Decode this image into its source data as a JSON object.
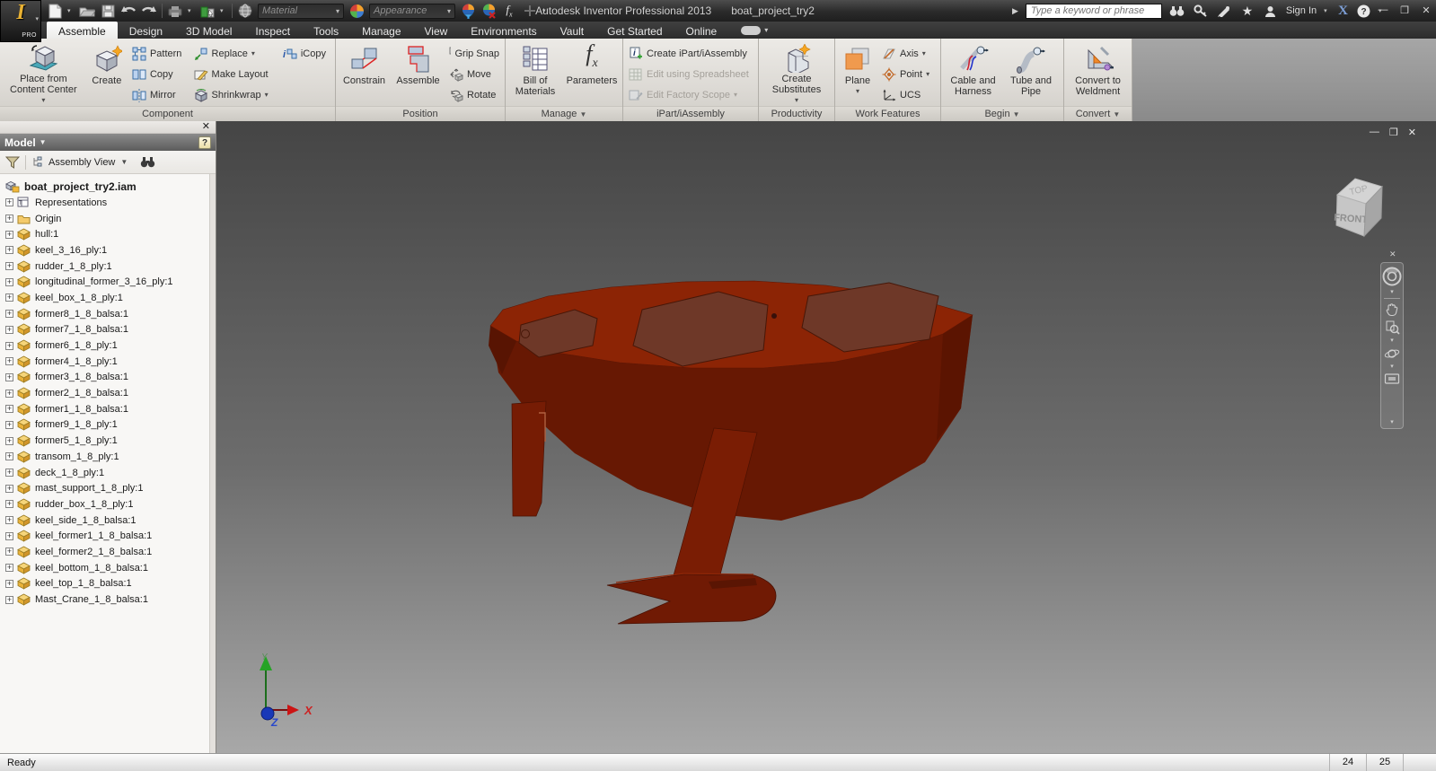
{
  "title_bar": {
    "app_badge": "PRO",
    "title": "Autodesk Inventor Professional 2013",
    "document": "boat_project_try2",
    "search_placeholder": "Type a keyword or phrase",
    "sign_in": "Sign In",
    "material_label": "Material",
    "appearance_label": "Appearance"
  },
  "tabs": [
    "Assemble",
    "Design",
    "3D Model",
    "Inspect",
    "Tools",
    "Manage",
    "View",
    "Environments",
    "Vault",
    "Get Started",
    "Online"
  ],
  "active_tab": "Assemble",
  "ribbon": {
    "component": {
      "label": "Component",
      "place": "Place from Content Center",
      "create": "Create",
      "pattern": "Pattern",
      "copy": "Copy",
      "mirror": "Mirror",
      "replace": "Replace",
      "make_layout": "Make Layout",
      "shrinkwrap": "Shrinkwrap",
      "icopy": "iCopy"
    },
    "position": {
      "label": "Position",
      "constrain": "Constrain",
      "assemble": "Assemble",
      "grip_snap": "Grip Snap",
      "move": "Move",
      "rotate": "Rotate"
    },
    "manage": {
      "label": "Manage",
      "bom": "Bill of Materials",
      "parameters": "Parameters"
    },
    "ipart": {
      "label": "iPart/iAssembly",
      "create": "Create iPart/iAssembly",
      "edit_spreadsheet": "Edit using Spreadsheet",
      "edit_factory": "Edit Factory Scope"
    },
    "productivity": {
      "label": "Productivity",
      "create_substitutes": "Create Substitutes"
    },
    "work_features": {
      "label": "Work Features",
      "plane": "Plane",
      "axis": "Axis",
      "point": "Point",
      "ucs": "UCS"
    },
    "begin": {
      "label": "Begin",
      "cable": "Cable and Harness",
      "tube": "Tube and Pipe"
    },
    "convert": {
      "label": "Convert",
      "weldment": "Convert to Weldment"
    }
  },
  "browser": {
    "panel_title": "Model",
    "view_mode": "Assembly View",
    "root": "boat_project_try2.iam",
    "items": [
      "Representations",
      "Origin",
      "hull:1",
      "keel_3_16_ply:1",
      "rudder_1_8_ply:1",
      "longitudinal_former_3_16_ply:1",
      "keel_box_1_8_ply:1",
      "former8_1_8_balsa:1",
      "former7_1_8_balsa:1",
      "former6_1_8_ply:1",
      "former4_1_8_ply:1",
      "former3_1_8_balsa:1",
      "former2_1_8_balsa:1",
      "former1_1_8_balsa:1",
      "former9_1_8_ply:1",
      "former5_1_8_ply:1",
      "transom_1_8_ply:1",
      "deck_1_8_ply:1",
      "mast_support_1_8_ply:1",
      "rudder_box_1_8_ply:1",
      "keel_side_1_8_balsa:1",
      "keel_former1_1_8_balsa:1",
      "keel_former2_1_8_balsa:1",
      "keel_bottom_1_8_balsa:1",
      "keel_top_1_8_balsa:1",
      "Mast_Crane_1_8_balsa:1"
    ]
  },
  "viewport": {
    "viewcube_top": "TOP",
    "viewcube_front": "FRONT",
    "axis_x": "X",
    "axis_y": "Y",
    "axis_z": "Z",
    "model_color": "#7c1d05",
    "background_top": "#454545",
    "background_bottom": "#a8a8a8"
  },
  "status_bar": {
    "message": "Ready",
    "counters": [
      "24",
      "25"
    ]
  }
}
